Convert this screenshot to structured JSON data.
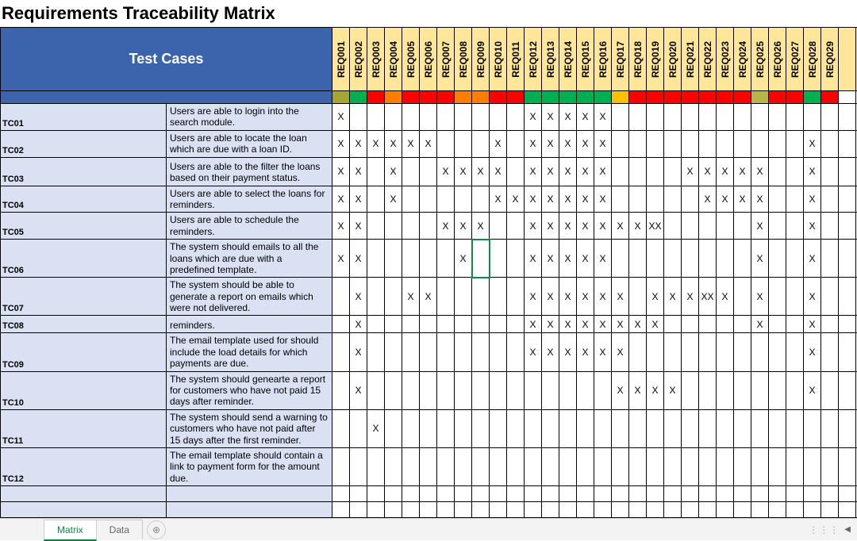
{
  "title": "Requirements Traceability Matrix",
  "header": {
    "test_cases_label": "Test Cases"
  },
  "requirements": [
    {
      "id": "REQ001",
      "color": "#a6a633"
    },
    {
      "id": "REQ002",
      "color": "#00b050"
    },
    {
      "id": "REQ003",
      "color": "#ff0000"
    },
    {
      "id": "REQ004",
      "color": "#ff7d00"
    },
    {
      "id": "REQ005",
      "color": "#ff0000"
    },
    {
      "id": "REQ006",
      "color": "#ff0000"
    },
    {
      "id": "REQ007",
      "color": "#ff0000"
    },
    {
      "id": "REQ008",
      "color": "#ff7d00"
    },
    {
      "id": "REQ009",
      "color": "#ff7d00"
    },
    {
      "id": "REQ010",
      "color": "#ff0000"
    },
    {
      "id": "REQ011",
      "color": "#ff0000"
    },
    {
      "id": "REQ012",
      "color": "#00b050"
    },
    {
      "id": "REQ013",
      "color": "#00b050"
    },
    {
      "id": "REQ014",
      "color": "#00b050"
    },
    {
      "id": "REQ015",
      "color": "#00b050"
    },
    {
      "id": "REQ016",
      "color": "#00b050"
    },
    {
      "id": "REQ017",
      "color": "#ffc000"
    },
    {
      "id": "REQ018",
      "color": "#ff0000"
    },
    {
      "id": "REQ019",
      "color": "#ff0000"
    },
    {
      "id": "REQ020",
      "color": "#ff0000"
    },
    {
      "id": "REQ021",
      "color": "#ff0000"
    },
    {
      "id": "REQ022",
      "color": "#ff0000"
    },
    {
      "id": "REQ023",
      "color": "#ff0000"
    },
    {
      "id": "REQ024",
      "color": "#ff0000"
    },
    {
      "id": "REQ025",
      "color": "#b5b548"
    },
    {
      "id": "REQ026",
      "color": "#ff0000"
    },
    {
      "id": "REQ027",
      "color": "#ff0000"
    },
    {
      "id": "REQ028",
      "color": "#00b050"
    },
    {
      "id": "REQ029",
      "color": "#ff0000"
    }
  ],
  "extra_cols": 2,
  "rows": [
    {
      "id": "TC01",
      "h": "row-h1",
      "desc": "Users are able to login into the search module.",
      "marks": [
        1,
        0,
        0,
        0,
        0,
        0,
        0,
        0,
        0,
        0,
        0,
        1,
        1,
        1,
        1,
        1,
        0,
        0,
        0,
        0,
        0,
        0,
        0,
        0,
        0,
        0,
        0,
        0,
        0
      ]
    },
    {
      "id": "TC02",
      "h": "row-h1",
      "desc": "Users are able to locate the loan which are due with a loan ID.",
      "marks": [
        1,
        1,
        1,
        1,
        1,
        1,
        0,
        0,
        0,
        1,
        0,
        1,
        1,
        1,
        1,
        1,
        0,
        0,
        0,
        0,
        0,
        0,
        0,
        0,
        0,
        0,
        0,
        1,
        0
      ]
    },
    {
      "id": "TC03",
      "h": "row-h2",
      "desc": "Users are able to the filter the loans based on their payment status.",
      "marks": [
        1,
        1,
        0,
        1,
        0,
        0,
        1,
        1,
        1,
        1,
        0,
        1,
        1,
        1,
        1,
        1,
        0,
        0,
        0,
        0,
        1,
        1,
        1,
        1,
        1,
        0,
        0,
        1,
        0
      ]
    },
    {
      "id": "TC04",
      "h": "row-h1",
      "desc": "Users are able to select the loans for reminders.",
      "marks": [
        1,
        1,
        0,
        1,
        0,
        0,
        0,
        0,
        0,
        1,
        1,
        1,
        1,
        1,
        1,
        1,
        0,
        0,
        0,
        0,
        0,
        1,
        1,
        1,
        1,
        0,
        0,
        1,
        0
      ]
    },
    {
      "id": "TC05",
      "h": "row-h1",
      "desc": "Users are able to schedule the reminders.",
      "marks": [
        1,
        1,
        0,
        0,
        0,
        0,
        1,
        1,
        1,
        0,
        0,
        1,
        1,
        1,
        1,
        1,
        1,
        1,
        2,
        0,
        0,
        0,
        0,
        0,
        1,
        0,
        0,
        1,
        0
      ]
    },
    {
      "id": "TC06",
      "h": "row-h2",
      "desc": "The system should emails to all the loans which are due with a predefined template.",
      "marks": [
        1,
        1,
        0,
        0,
        0,
        0,
        0,
        1,
        0,
        0,
        0,
        1,
        1,
        1,
        1,
        1,
        0,
        0,
        0,
        0,
        0,
        0,
        0,
        0,
        1,
        0,
        0,
        1,
        0
      ],
      "sel": 8
    },
    {
      "id": "TC07",
      "h": "row-h2",
      "desc": "The system should be able to generate a report on emails which were not delivered.",
      "marks": [
        0,
        1,
        0,
        0,
        1,
        1,
        0,
        0,
        0,
        0,
        0,
        1,
        1,
        1,
        1,
        1,
        1,
        0,
        1,
        1,
        1,
        2,
        1,
        0,
        1,
        0,
        0,
        1,
        0
      ]
    },
    {
      "id": "TC08",
      "h": "row-h1",
      "desc": "reminders.",
      "marks": [
        0,
        1,
        0,
        0,
        0,
        0,
        0,
        0,
        0,
        0,
        0,
        1,
        1,
        1,
        1,
        1,
        1,
        1,
        1,
        0,
        0,
        0,
        0,
        0,
        1,
        0,
        0,
        1,
        0
      ]
    },
    {
      "id": "TC09",
      "h": "row-h2",
      "desc": "The email template used for should include the load details for which payments are due.",
      "marks": [
        0,
        1,
        0,
        0,
        0,
        0,
        0,
        0,
        0,
        0,
        0,
        1,
        1,
        1,
        1,
        1,
        1,
        0,
        0,
        0,
        0,
        0,
        0,
        0,
        0,
        0,
        0,
        1,
        0
      ]
    },
    {
      "id": "TC10",
      "h": "row-h2",
      "desc": "The system should genearte a report for customers who have not paid 15 days after reminder.",
      "marks": [
        0,
        1,
        0,
        0,
        0,
        0,
        0,
        0,
        0,
        0,
        0,
        0,
        0,
        0,
        0,
        0,
        1,
        1,
        1,
        1,
        0,
        0,
        0,
        0,
        0,
        0,
        0,
        1,
        0
      ]
    },
    {
      "id": "TC11",
      "h": "row-h2",
      "desc": "The system should send a warning to customers who have not paid after 15 days after the first reminder.",
      "marks": [
        0,
        0,
        1,
        0,
        0,
        0,
        0,
        0,
        0,
        0,
        0,
        0,
        0,
        0,
        0,
        0,
        0,
        0,
        0,
        0,
        0,
        0,
        0,
        0,
        0,
        0,
        0,
        0,
        0
      ]
    },
    {
      "id": "TC12",
      "h": "row-h2",
      "desc": "The email template should contain a link to payment form for the amount due.",
      "marks": [
        0,
        0,
        0,
        0,
        0,
        0,
        0,
        0,
        0,
        0,
        0,
        0,
        0,
        0,
        0,
        0,
        0,
        0,
        0,
        0,
        0,
        0,
        0,
        0,
        0,
        0,
        0,
        0,
        0
      ]
    }
  ],
  "blank_rows": 2,
  "tabs": {
    "active": "Matrix",
    "items": [
      "Matrix",
      "Data"
    ],
    "add_glyph": "⊕"
  },
  "mark_glyph": {
    "1": "X",
    "2": "XX"
  }
}
